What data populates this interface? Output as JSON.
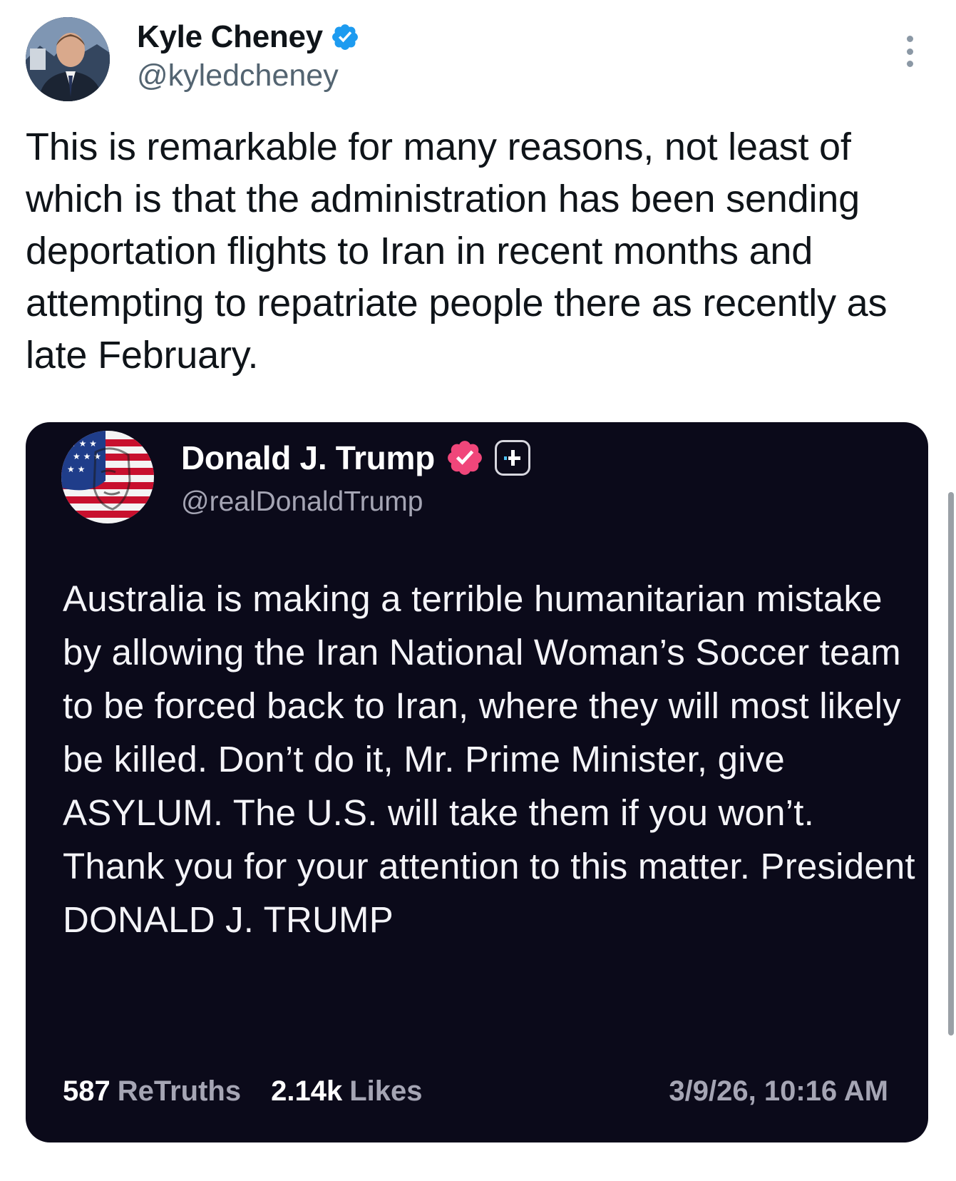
{
  "tweet": {
    "author_name": "Kyle Cheney",
    "author_handle": "@kyledcheney",
    "text": "This is remarkable for many reasons, not least of which is that the administration has been sending deportation flights to Iran in recent months and attempting to repatriate people there as recently as late February.",
    "verified_icon": "verified-badge-icon",
    "more_icon": "more-options-icon"
  },
  "embedded_post": {
    "author_name": "Donald J. Trump",
    "author_handle": "@realDonaldTrump",
    "text": "Australia is making a terrible humanitarian mistake by allowing the Iran National Woman’s Soccer team to be forced back to Iran, where they will most likely be killed. Don’t do it, Mr. Prime Minister, give ASYLUM. The U.S. will take them if you won’t. Thank you for your attention to this matter. President DONALD J. TRUMP",
    "retruths_count": "587",
    "retruths_label": "ReTruths",
    "likes_count": "2.14k",
    "likes_label": "Likes",
    "timestamp": "3/9/26, 10:16 AM",
    "verified_icon": "verified-badge-icon",
    "plus_icon": "plus-badge-icon"
  },
  "colors": {
    "page_background": "#ffffff",
    "primary_text": "#0f1419",
    "secondary_text": "#536471",
    "verified_blue": "#1d9bf0",
    "card_background": "#0b0a1a",
    "card_text": "#f4f4f8",
    "card_secondary_text": "#a5a5b4",
    "verified_pink": "#f0467a"
  }
}
